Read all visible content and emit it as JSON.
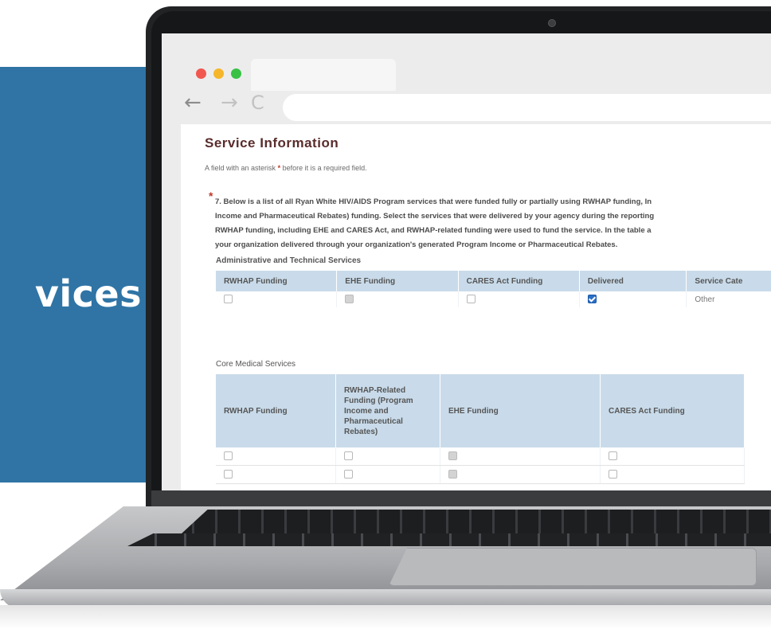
{
  "slide": {
    "title_fragment": "vices"
  },
  "browser": {
    "window_controls": [
      "close",
      "minimize",
      "maximize"
    ],
    "nav_icons": {
      "back": "←",
      "forward": "→",
      "reload": "C"
    },
    "address_value": ""
  },
  "form": {
    "title": "Service Information",
    "required_note_before": "A field with an asterisk",
    "required_star": "*",
    "required_note_after": "before it is a required field.",
    "question_star": "*",
    "question_lines": [
      "7. Below is a list of all Ryan White HIV/AIDS Program services that were funded fully or partially using RWHAP funding, In",
      "Income and Pharmaceutical Rebates) funding. Select the services that were delivered by your agency during the reporting",
      "RWHAP funding, including EHE and CARES Act, and RWHAP-related funding were used to fund the service. In the table a",
      "your organization delivered through your organization's generated Program Income or Pharmaceutical Rebates."
    ],
    "section1": {
      "title": "Administrative and Technical Services",
      "headers": [
        "RWHAP Funding",
        "EHE Funding",
        "CARES Act Funding",
        "Delivered",
        "Service Cate"
      ],
      "row": {
        "rwhap": false,
        "ehe": "disabled",
        "cares": false,
        "delivered": true,
        "category": "Other"
      }
    },
    "section2": {
      "title": "Core Medical Services",
      "headers": [
        "RWHAP Funding",
        "RWHAP-Related Funding (Program Income and Pharmaceutical Rebates)",
        "EHE Funding",
        "CARES Act Funding"
      ],
      "rows": [
        {
          "rwhap": false,
          "related": false,
          "ehe": "disabled",
          "cares": false
        },
        {
          "rwhap": false,
          "related": false,
          "ehe": "disabled",
          "cares": false
        }
      ]
    }
  },
  "colors": {
    "slide_blue": "#2f74a5",
    "table_header": "#c9dbea",
    "title_color": "#5a2c2c",
    "required_red": "#c0392b",
    "checked_blue": "#2a6fc7"
  }
}
